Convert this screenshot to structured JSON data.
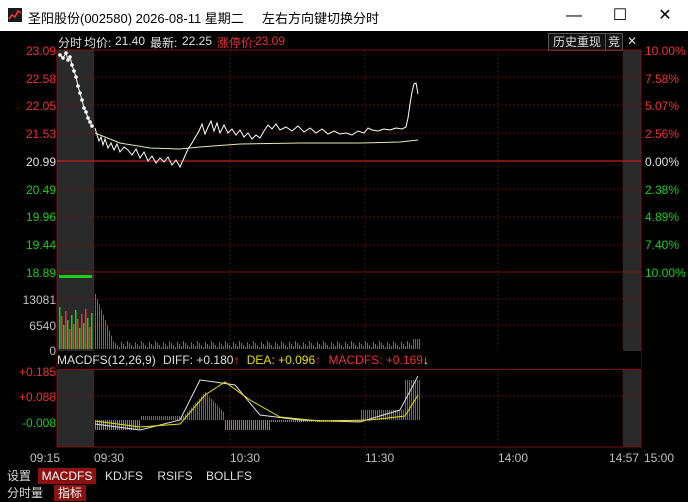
{
  "window": {
    "title": "圣阳股份(002580)  2026-08-11  星期二",
    "hint": "左右方向键切换分时",
    "min_glyph": "—",
    "max_glyph": "☐",
    "close_glyph": "✕"
  },
  "infobar": {
    "mode": "分时",
    "avg_label": "均价:",
    "avg_value": "21.40",
    "latest_label": "最新:",
    "latest_value": "22.25",
    "limit_label": "涨停价:",
    "limit_value": "23.09",
    "history_btn": "历史重现",
    "compete_btn": "竞",
    "close_btn": "✕"
  },
  "price_axis": {
    "left": [
      "23.09",
      "22.58",
      "22.05",
      "21.53",
      "20.99",
      "20.49",
      "19.96",
      "19.44",
      "18.89"
    ],
    "right_up": [
      "10.00%",
      "7.58%",
      "5.07%",
      "2.56%",
      "0.00%"
    ],
    "right_down": [
      "2.38%",
      "4.89%",
      "7.40%",
      "10.00%"
    ]
  },
  "volume_axis": [
    "13081",
    "6540",
    "0"
  ],
  "macd": {
    "name": "MACDFS(12,26,9)",
    "diff": "DIFF: +0.180",
    "dea": "DEA: +0.096",
    "macdfs": "MACDFS: +0.169",
    "axis": [
      "+0.185",
      "+0.088",
      "-0.008"
    ]
  },
  "times": [
    "09:15",
    "09:30",
    "10:30",
    "11:30",
    "14:00",
    "14:57",
    "15:00"
  ],
  "tabs": {
    "row1": [
      "设置",
      "MACDFS",
      "KDJFS",
      "RSIFS",
      "BOLLFS"
    ],
    "row2": [
      "分时量",
      "指标"
    ]
  },
  "colors": {
    "up": "#f03030",
    "down": "#16d016",
    "price_line": "#ffffff",
    "avg_line": "#e8e8b0",
    "grid": "#7a1010",
    "label_white": "#e0e0e0",
    "dea": "#e8e000"
  }
}
